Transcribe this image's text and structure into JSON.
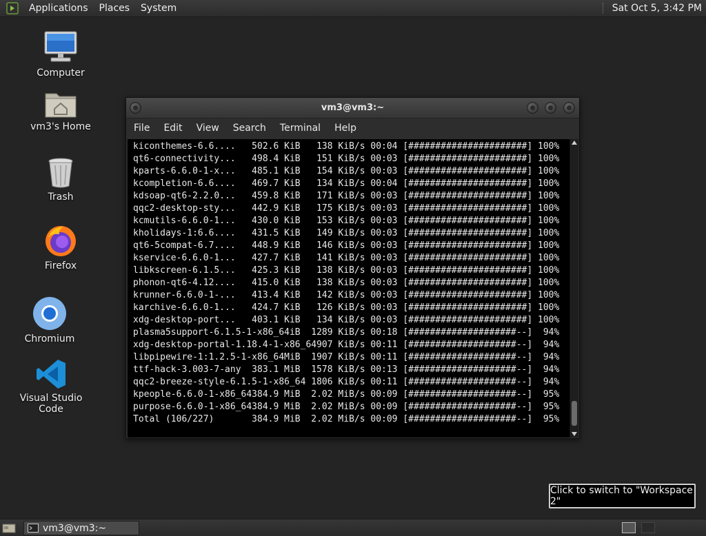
{
  "top_panel": {
    "menus": [
      "Applications",
      "Places",
      "System"
    ],
    "clock": "Sat Oct  5,  3:42 PM"
  },
  "desktop_icons": [
    {
      "label": "Computer",
      "icon": "computer-icon"
    },
    {
      "label": "vm3's Home",
      "icon": "home-folder-icon"
    },
    {
      "label": "Trash",
      "icon": "trash-icon"
    },
    {
      "label": "Firefox",
      "icon": "firefox-icon"
    },
    {
      "label": "Chromium",
      "icon": "chromium-icon"
    },
    {
      "label": "Visual Studio Code",
      "icon": "vscode-icon"
    }
  ],
  "terminal": {
    "title": "vm3@vm3:~",
    "menu": [
      "File",
      "Edit",
      "View",
      "Search",
      "Terminal",
      "Help"
    ],
    "lines": [
      "kiconthemes-6.6....   502.6 KiB   138 KiB/s 00:04 [######################] 100%",
      "qt6-connectivity...   498.4 KiB   151 KiB/s 00:03 [######################] 100%",
      "kparts-6.6.0-1-x...   485.1 KiB   154 KiB/s 00:03 [######################] 100%",
      "kcompletion-6.6....   469.7 KiB   134 KiB/s 00:04 [######################] 100%",
      "kdsoap-qt6-2.2.0...   459.8 KiB   171 KiB/s 00:03 [######################] 100%",
      "qqc2-desktop-sty...   442.9 KiB   175 KiB/s 00:03 [######################] 100%",
      "kcmutils-6.6.0-1...   430.0 KiB   153 KiB/s 00:03 [######################] 100%",
      "kholidays-1:6.6....   431.5 KiB   149 KiB/s 00:03 [######################] 100%",
      "qt6-5compat-6.7....   448.9 KiB   146 KiB/s 00:03 [######################] 100%",
      "kservice-6.6.0-1...   427.7 KiB   141 KiB/s 00:03 [######################] 100%",
      "libkscreen-6.1.5...   425.3 KiB   138 KiB/s 00:03 [######################] 100%",
      "phonon-qt6-4.12....   415.0 KiB   138 KiB/s 00:03 [######################] 100%",
      "krunner-6.6.0-1-...   413.4 KiB   142 KiB/s 00:03 [######################] 100%",
      "karchive-6.6.0-1...   424.7 KiB   126 KiB/s 00:03 [######################] 100%",
      "xdg-desktop-port...   403.1 KiB   134 KiB/s 00:03 [######################] 100%",
      "plasma5support-6.1.5-1-x86_64iB  1289 KiB/s 00:18 [####################--]  94%",
      "xdg-desktop-portal-1.18.4-1-x86_64907 KiB/s 00:11 [####################--]  94%",
      "libpipewire-1:1.2.5-1-x86_64MiB  1907 KiB/s 00:11 [####################--]  94%",
      "ttf-hack-3.003-7-any  383.1 MiB  1578 KiB/s 00:13 [####################--]  94%",
      "qqc2-breeze-style-6.1.5-1-x86_64 1806 KiB/s 00:11 [####################--]  94%",
      "kpeople-6.6.0-1-x86_64384.9 MiB  2.02 MiB/s 00:09 [####################--]  95%",
      "purpose-6.6.0-1-x86_64384.9 MiB  2.02 MiB/s 00:09 [####################--]  95%",
      "Total (106/227)       384.9 MiB  2.02 MiB/s 00:09 [####################--]  95%"
    ]
  },
  "tooltip": "Click to switch to \"Workspace 2\"",
  "bottom_panel": {
    "task_label": "vm3@vm3:~"
  }
}
